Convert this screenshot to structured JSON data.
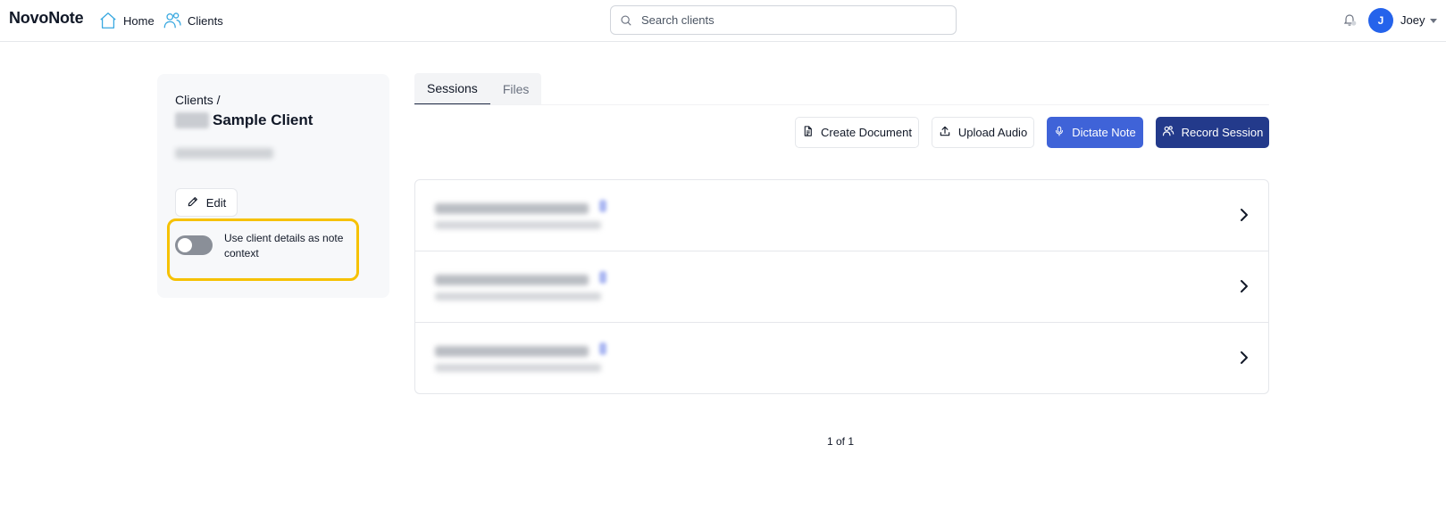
{
  "header": {
    "brand": "NovoNote",
    "nav": [
      {
        "label": "Home",
        "icon": "home-icon"
      },
      {
        "label": "Clients",
        "icon": "users-icon"
      }
    ],
    "search_placeholder": "Search clients",
    "avatar_initial": "J",
    "user_name": "Joey"
  },
  "client": {
    "breadcrumb": "Clients /",
    "name": "Sample Client",
    "edit_label": "Edit",
    "toggle_label": "Use client details as note context",
    "toggle_on": false
  },
  "tabs": [
    {
      "label": "Sessions",
      "active": true
    },
    {
      "label": "Files",
      "active": false
    }
  ],
  "actions": {
    "create_document": "Create Document",
    "upload_audio": "Upload Audio",
    "dictate_note": "Dictate Note",
    "record_session": "Record Session"
  },
  "colors": {
    "accent": "#3f63d8",
    "primary_dark": "#233a8b",
    "avatar": "#2563eb",
    "highlight": "#f6c100"
  },
  "pager": "1 of 1"
}
